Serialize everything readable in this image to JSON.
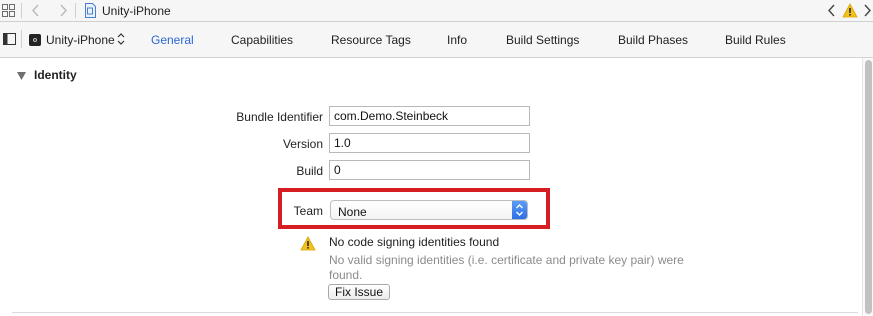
{
  "jumpbar": {
    "title": "Unity-iPhone",
    "icons": [
      "grid-icon",
      "back-arrow-icon",
      "forward-arrow-icon",
      "project-file-icon",
      "issue-back-icon",
      "warning-icon",
      "issue-forward-icon"
    ]
  },
  "tabbar": {
    "target": "Unity-iPhone",
    "tabs": [
      {
        "label": "General",
        "active": true
      },
      {
        "label": "Capabilities",
        "active": false
      },
      {
        "label": "Resource Tags",
        "active": false
      },
      {
        "label": "Info",
        "active": false
      },
      {
        "label": "Build Settings",
        "active": false
      },
      {
        "label": "Build Phases",
        "active": false
      },
      {
        "label": "Build Rules",
        "active": false
      }
    ],
    "active_color": "#2b68d8"
  },
  "identity": {
    "section_title": "Identity",
    "bundle_identifier_label": "Bundle Identifier",
    "bundle_identifier_value": "com.Demo.Steinbeck",
    "version_label": "Version",
    "version_value": "1.0",
    "build_label": "Build",
    "build_value": "0",
    "team_label": "Team",
    "team_value": "None",
    "highlight_color": "#d51d22"
  },
  "warning": {
    "title": "No code signing identities found",
    "description": "No valid signing identities (i.e. certificate and private key pair) were found.",
    "fix_button": "Fix Issue",
    "icon_color": "#f2c21b"
  }
}
